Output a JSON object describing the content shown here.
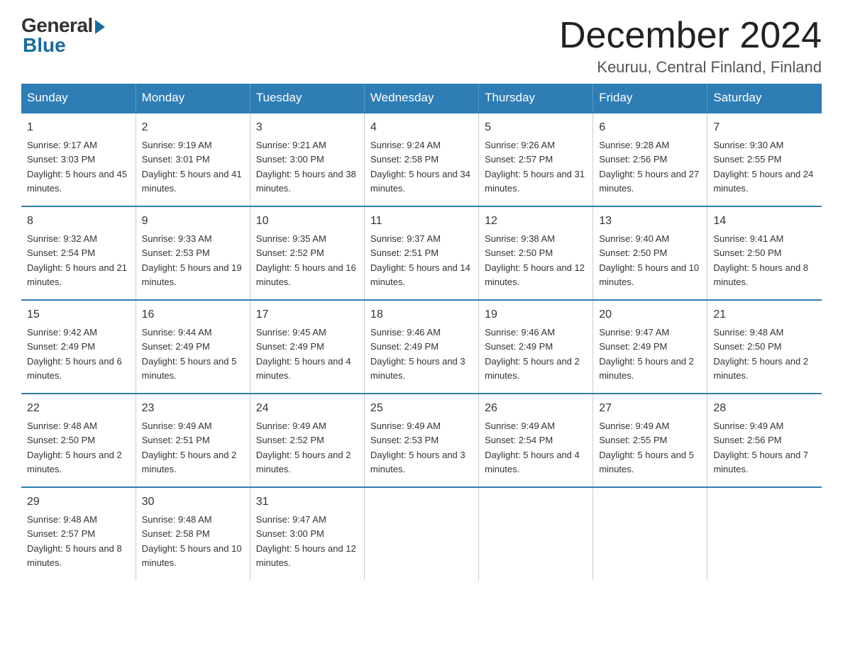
{
  "header": {
    "logo": {
      "general": "General",
      "blue": "Blue"
    },
    "title": "December 2024",
    "location": "Keuruu, Central Finland, Finland"
  },
  "weekdays": [
    "Sunday",
    "Monday",
    "Tuesday",
    "Wednesday",
    "Thursday",
    "Friday",
    "Saturday"
  ],
  "weeks": [
    [
      {
        "day": "1",
        "sunrise": "9:17 AM",
        "sunset": "3:03 PM",
        "daylight": "5 hours and 45 minutes."
      },
      {
        "day": "2",
        "sunrise": "9:19 AM",
        "sunset": "3:01 PM",
        "daylight": "5 hours and 41 minutes."
      },
      {
        "day": "3",
        "sunrise": "9:21 AM",
        "sunset": "3:00 PM",
        "daylight": "5 hours and 38 minutes."
      },
      {
        "day": "4",
        "sunrise": "9:24 AM",
        "sunset": "2:58 PM",
        "daylight": "5 hours and 34 minutes."
      },
      {
        "day": "5",
        "sunrise": "9:26 AM",
        "sunset": "2:57 PM",
        "daylight": "5 hours and 31 minutes."
      },
      {
        "day": "6",
        "sunrise": "9:28 AM",
        "sunset": "2:56 PM",
        "daylight": "5 hours and 27 minutes."
      },
      {
        "day": "7",
        "sunrise": "9:30 AM",
        "sunset": "2:55 PM",
        "daylight": "5 hours and 24 minutes."
      }
    ],
    [
      {
        "day": "8",
        "sunrise": "9:32 AM",
        "sunset": "2:54 PM",
        "daylight": "5 hours and 21 minutes."
      },
      {
        "day": "9",
        "sunrise": "9:33 AM",
        "sunset": "2:53 PM",
        "daylight": "5 hours and 19 minutes."
      },
      {
        "day": "10",
        "sunrise": "9:35 AM",
        "sunset": "2:52 PM",
        "daylight": "5 hours and 16 minutes."
      },
      {
        "day": "11",
        "sunrise": "9:37 AM",
        "sunset": "2:51 PM",
        "daylight": "5 hours and 14 minutes."
      },
      {
        "day": "12",
        "sunrise": "9:38 AM",
        "sunset": "2:50 PM",
        "daylight": "5 hours and 12 minutes."
      },
      {
        "day": "13",
        "sunrise": "9:40 AM",
        "sunset": "2:50 PM",
        "daylight": "5 hours and 10 minutes."
      },
      {
        "day": "14",
        "sunrise": "9:41 AM",
        "sunset": "2:50 PM",
        "daylight": "5 hours and 8 minutes."
      }
    ],
    [
      {
        "day": "15",
        "sunrise": "9:42 AM",
        "sunset": "2:49 PM",
        "daylight": "5 hours and 6 minutes."
      },
      {
        "day": "16",
        "sunrise": "9:44 AM",
        "sunset": "2:49 PM",
        "daylight": "5 hours and 5 minutes."
      },
      {
        "day": "17",
        "sunrise": "9:45 AM",
        "sunset": "2:49 PM",
        "daylight": "5 hours and 4 minutes."
      },
      {
        "day": "18",
        "sunrise": "9:46 AM",
        "sunset": "2:49 PM",
        "daylight": "5 hours and 3 minutes."
      },
      {
        "day": "19",
        "sunrise": "9:46 AM",
        "sunset": "2:49 PM",
        "daylight": "5 hours and 2 minutes."
      },
      {
        "day": "20",
        "sunrise": "9:47 AM",
        "sunset": "2:49 PM",
        "daylight": "5 hours and 2 minutes."
      },
      {
        "day": "21",
        "sunrise": "9:48 AM",
        "sunset": "2:50 PM",
        "daylight": "5 hours and 2 minutes."
      }
    ],
    [
      {
        "day": "22",
        "sunrise": "9:48 AM",
        "sunset": "2:50 PM",
        "daylight": "5 hours and 2 minutes."
      },
      {
        "day": "23",
        "sunrise": "9:49 AM",
        "sunset": "2:51 PM",
        "daylight": "5 hours and 2 minutes."
      },
      {
        "day": "24",
        "sunrise": "9:49 AM",
        "sunset": "2:52 PM",
        "daylight": "5 hours and 2 minutes."
      },
      {
        "day": "25",
        "sunrise": "9:49 AM",
        "sunset": "2:53 PM",
        "daylight": "5 hours and 3 minutes."
      },
      {
        "day": "26",
        "sunrise": "9:49 AM",
        "sunset": "2:54 PM",
        "daylight": "5 hours and 4 minutes."
      },
      {
        "day": "27",
        "sunrise": "9:49 AM",
        "sunset": "2:55 PM",
        "daylight": "5 hours and 5 minutes."
      },
      {
        "day": "28",
        "sunrise": "9:49 AM",
        "sunset": "2:56 PM",
        "daylight": "5 hours and 7 minutes."
      }
    ],
    [
      {
        "day": "29",
        "sunrise": "9:48 AM",
        "sunset": "2:57 PM",
        "daylight": "5 hours and 8 minutes."
      },
      {
        "day": "30",
        "sunrise": "9:48 AM",
        "sunset": "2:58 PM",
        "daylight": "5 hours and 10 minutes."
      },
      {
        "day": "31",
        "sunrise": "9:47 AM",
        "sunset": "3:00 PM",
        "daylight": "5 hours and 12 minutes."
      },
      null,
      null,
      null,
      null
    ]
  ],
  "labels": {
    "sunrise": "Sunrise: ",
    "sunset": "Sunset: ",
    "daylight": "Daylight: "
  }
}
